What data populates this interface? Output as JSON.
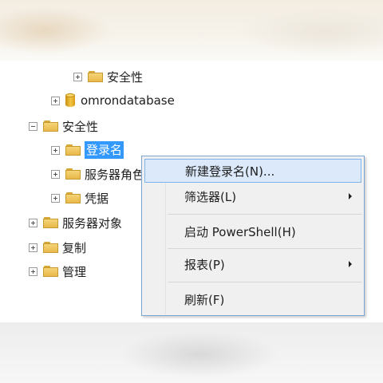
{
  "tree": {
    "items": [
      {
        "label": "安全性"
      },
      {
        "label": "omrondatabase"
      },
      {
        "label": "安全性"
      },
      {
        "label": "登录名"
      },
      {
        "label": "服务器角色"
      },
      {
        "label": "凭据"
      },
      {
        "label": "服务器对象"
      },
      {
        "label": "复制"
      },
      {
        "label": "管理"
      }
    ]
  },
  "context_menu": {
    "items": [
      {
        "label": "新建登录名(N)..."
      },
      {
        "label": "筛选器(L)"
      },
      {
        "label": "启动 PowerShell(H)"
      },
      {
        "label": "报表(P)"
      },
      {
        "label": "刷新(F)"
      }
    ]
  },
  "colors": {
    "selection": "#3399ff",
    "menu_highlight": "#dbe9fa",
    "menu_border": "#7ba6d4"
  }
}
